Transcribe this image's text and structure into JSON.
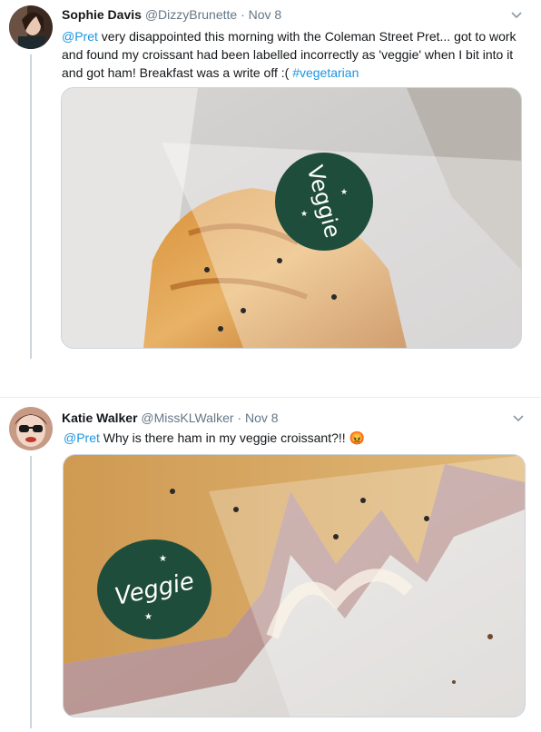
{
  "tweets": [
    {
      "name": "Sophie Davis",
      "handle": "@DizzyBrunette",
      "sep": "·",
      "date": "Nov 8",
      "mention": "@Pret",
      "text": " very disappointed this morning with the Coleman Street Pret... got to work and found my croissant had been labelled incorrectly as 'veggie' when I bit into it and got ham! Breakfast was a write off :( ",
      "hashtag": "#vegetarian",
      "sticker": "Veggie"
    },
    {
      "name": "Katie Walker",
      "handle": "@MissKLWalker",
      "sep": "·",
      "date": "Nov 8",
      "mention": "@Pret",
      "text": " Why is there ham in my veggie  croissant?!! ",
      "emoji": "😡",
      "sticker": "Veggie"
    }
  ],
  "colors": {
    "link": "#1b95e0",
    "secondary_text": "#657786",
    "sticker_green": "#1f4d3c"
  },
  "icons": [
    "chevron-down-icon",
    "angry-face-emoji"
  ]
}
